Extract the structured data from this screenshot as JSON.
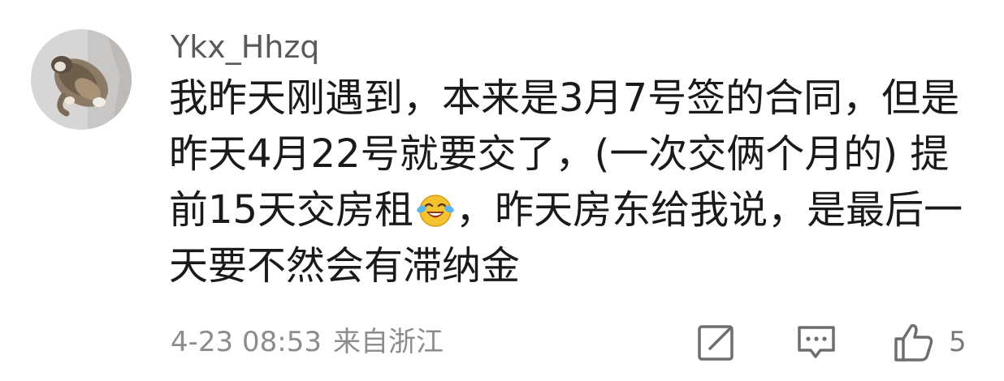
{
  "comment": {
    "username": "Ykx_Hhzq",
    "text_lines": [
      "我昨天刚遇到，本来是3月7号签的合同，但是",
      "昨天4月22号就要交了，(一次交俩个月的) 提",
      "前15天交房租",
      "，昨天房东给我说，是最后一",
      "天要不然会有滞纳金"
    ],
    "emoji": "laughing-tears-emoji",
    "timestamp": "4-23 08:53",
    "location": "来自浙江",
    "like_count": "5"
  },
  "icons": {
    "edit": "edit-icon",
    "reply": "comment-icon",
    "like": "thumbs-up-icon"
  },
  "colors": {
    "text": "#1a1a1a",
    "username": "#5a5a5a",
    "meta": "#8c8c8c",
    "icon": "#6e6e6e",
    "emoji_face": "#f5c230"
  }
}
